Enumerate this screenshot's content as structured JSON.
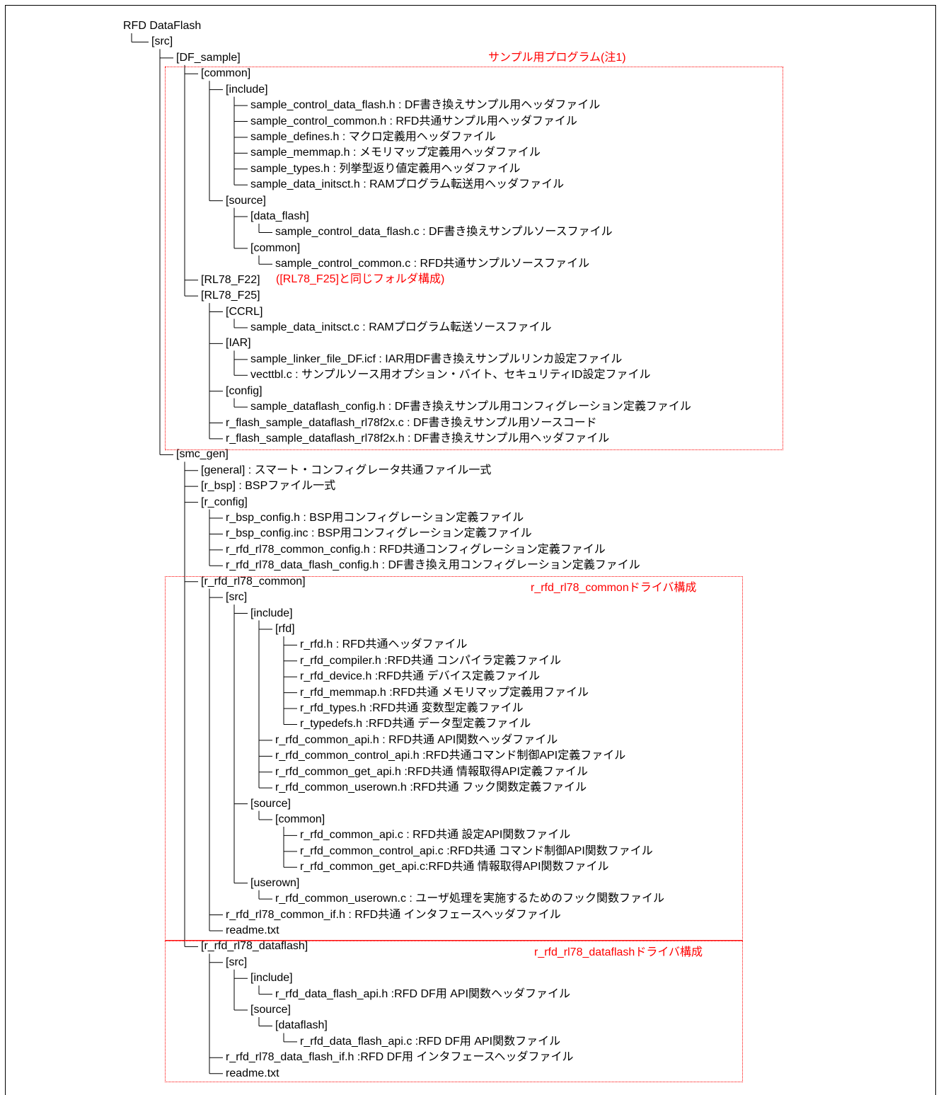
{
  "tree": [
    {
      "text": "RFD DataFlash",
      "level": 0
    },
    {
      "text": "[src]",
      "level": 1
    },
    {
      "text": "[DF_sample]",
      "level": 2
    },
    {
      "text": "[common]",
      "level": 3
    },
    {
      "text": "[include]",
      "level": 4
    },
    {
      "text": "sample_control_data_flash.h : DF書き換えサンプル用ヘッダファイル",
      "level": 5
    },
    {
      "text": "sample_control_common.h : RFD共通サンプル用ヘッダファイル",
      "level": 5
    },
    {
      "text": "sample_defines.h : マクロ定義用ヘッダファイル",
      "level": 5
    },
    {
      "text": "sample_memmap.h : メモリマップ定義用ヘッダファイル",
      "level": 5
    },
    {
      "text": "sample_types.h : 列挙型返り値定義用ヘッダファイル",
      "level": 5
    },
    {
      "text": "sample_data_initsct.h : RAMプログラム転送用ヘッダファイル",
      "level": 5
    },
    {
      "text": "[source]",
      "level": 4
    },
    {
      "text": "[data_flash]",
      "level": 5
    },
    {
      "text": "sample_control_data_flash.c : DF書き換えサンプルソースファイル",
      "level": 6
    },
    {
      "text": "[common]",
      "level": 5
    },
    {
      "text": "sample_control_common.c : RFD共通サンプルソースファイル",
      "level": 6
    },
    {
      "text": "[RL78_F22]",
      "level": 3
    },
    {
      "text": "[RL78_F25]",
      "level": 3
    },
    {
      "text": "[CCRL]",
      "level": 4
    },
    {
      "text": "sample_data_initsct.c : RAMプログラム転送ソースファイル",
      "level": 5
    },
    {
      "text": "[IAR]",
      "level": 4
    },
    {
      "text": "sample_linker_file_DF.icf : IAR用DF書き換えサンプルリンカ設定ファイル",
      "level": 5
    },
    {
      "text": "vecttbl.c : サンプルソース用オプション・バイト、セキュリティID設定ファイル",
      "level": 5
    },
    {
      "text": "[config]",
      "level": 4
    },
    {
      "text": "sample_dataflash_config.h : DF書き換えサンプル用コンフィグレーション定義ファイル",
      "level": 5
    },
    {
      "text": "r_flash_sample_dataflash_rl78f2x.c : DF書き換えサンプル用ソースコード",
      "level": 4
    },
    {
      "text": "r_flash_sample_dataflash_rl78f2x.h : DF書き換えサンプル用ヘッダファイル",
      "level": 4
    },
    {
      "text": "[smc_gen]",
      "level": 2
    },
    {
      "text": "[general] : スマート・コンフィグレータ共通ファイル一式",
      "level": 3
    },
    {
      "text": "[r_bsp] : BSPファイル一式",
      "level": 3
    },
    {
      "text": "[r_config]",
      "level": 3
    },
    {
      "text": "r_bsp_config.h : BSP用コンフィグレーション定義ファイル",
      "level": 4
    },
    {
      "text": "r_bsp_config.inc : BSP用コンフィグレーション定義ファイル",
      "level": 4
    },
    {
      "text": "r_rfd_rl78_common_config.h : RFD共通コンフィグレーション定義ファイル",
      "level": 4
    },
    {
      "text": "r_rfd_rl78_data_flash_config.h : DF書き換え用コンフィグレーション定義ファイル",
      "level": 4
    },
    {
      "text": "[r_rfd_rl78_common]",
      "level": 3
    },
    {
      "text": "[src]",
      "level": 4
    },
    {
      "text": "[include]",
      "level": 5
    },
    {
      "text": "[rfd]",
      "level": 6
    },
    {
      "text": "r_rfd.h : RFD共通ヘッダファイル",
      "level": 7
    },
    {
      "text": "r_rfd_compiler.h :RFD共通 コンパイラ定義ファイル",
      "level": 7
    },
    {
      "text": "r_rfd_device.h :RFD共通 デバイス定義ファイル",
      "level": 7
    },
    {
      "text": "r_rfd_memmap.h :RFD共通 メモリマップ定義用ファイル",
      "level": 7
    },
    {
      "text": "r_rfd_types.h :RFD共通 変数型定義ファイル",
      "level": 7
    },
    {
      "text": "r_typedefs.h :RFD共通 データ型定義ファイル",
      "level": 7
    },
    {
      "text": "r_rfd_common_api.h : RFD共通 API関数ヘッダファイル",
      "level": 6
    },
    {
      "text": "r_rfd_common_control_api.h :RFD共通コマンド制御API定義ファイル",
      "level": 6
    },
    {
      "text": "r_rfd_common_get_api.h :RFD共通 情報取得API定義ファイル",
      "level": 6
    },
    {
      "text": "r_rfd_common_userown.h :RFD共通 フック関数定義ファイル",
      "level": 6
    },
    {
      "text": "[source]",
      "level": 5
    },
    {
      "text": "[common]",
      "level": 6
    },
    {
      "text": "r_rfd_common_api.c : RFD共通 設定API関数ファイル",
      "level": 7
    },
    {
      "text": "r_rfd_common_control_api.c :RFD共通 コマンド制御API関数ファイル",
      "level": 7
    },
    {
      "text": "r_rfd_common_get_api.c:RFD共通 情報取得API関数ファイル",
      "level": 7
    },
    {
      "text": "[userown]",
      "level": 5
    },
    {
      "text": "r_rfd_common_userown.c : ユーザ処理を実施するためのフック関数ファイル",
      "level": 6
    },
    {
      "text": "r_rfd_rl78_common_if.h : RFD共通 インタフェースヘッダファイル",
      "level": 4
    },
    {
      "text": "readme.txt",
      "level": 4
    },
    {
      "text": "[r_rfd_rl78_dataflash]",
      "level": 3
    },
    {
      "text": "[src]",
      "level": 4
    },
    {
      "text": "[include]",
      "level": 5
    },
    {
      "text": "r_rfd_data_flash_api.h :RFD DF用 API関数ヘッダファイル",
      "level": 6
    },
    {
      "text": "[source]",
      "level": 5
    },
    {
      "text": "[dataflash]",
      "level": 6
    },
    {
      "text": "r_rfd_data_flash_api.c :RFD DF用 API関数ファイル",
      "level": 7
    },
    {
      "text": "r_rfd_rl78_data_flash_if.h :RFD DF用 インタフェースヘッダファイル",
      "level": 4
    },
    {
      "text": "readme.txt",
      "level": 4
    }
  ],
  "annotations": {
    "sample_program": "サンプル用プログラム(注1)",
    "rl78_f22_note": "([RL78_F25]と同じフォルダ構成)",
    "common_driver": "r_rfd_rl78_commonドライバ構成",
    "dataflash_driver": "r_rfd_rl78_dataflashドライバ構成"
  },
  "colors": {
    "annotation": "#ff0000",
    "text": "#000000",
    "lines": "#000000"
  }
}
